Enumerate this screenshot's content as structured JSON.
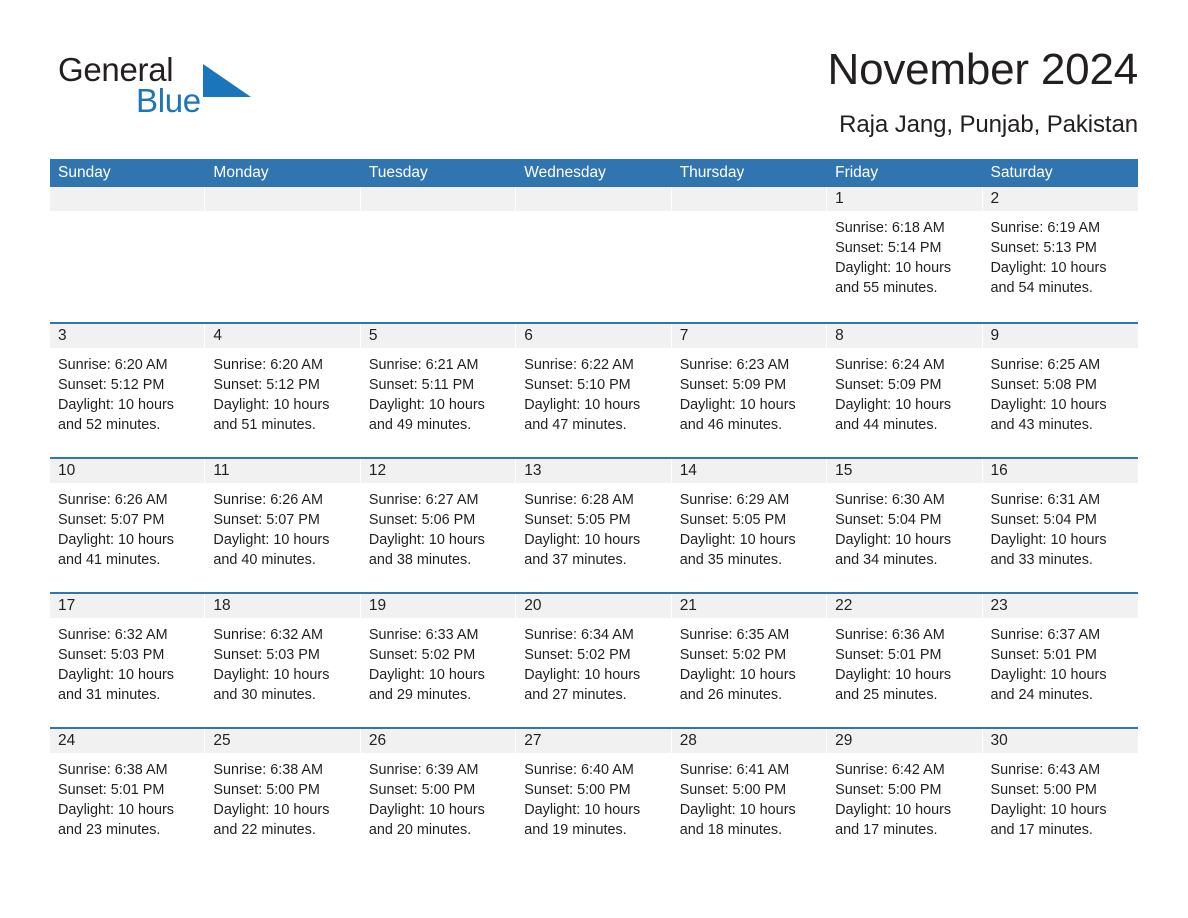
{
  "brand": {
    "name_part1": "General",
    "name_part2": "Blue",
    "triangle_icon": "blue-triangle-icon",
    "accent_color": "#1b75bb"
  },
  "header": {
    "title": "November 2024",
    "subtitle": "Raja Jang, Punjab, Pakistan"
  },
  "colors": {
    "header_blue": "#3175b0",
    "day_band_gray": "#f1f1f1",
    "text": "#231f20",
    "logo_blue": "#1b75bb"
  },
  "weekdays": [
    "Sunday",
    "Monday",
    "Tuesday",
    "Wednesday",
    "Thursday",
    "Friday",
    "Saturday"
  ],
  "weeks": [
    [
      {
        "day": "",
        "sunrise": "",
        "sunset": "",
        "daylight_1": "",
        "daylight_2": ""
      },
      {
        "day": "",
        "sunrise": "",
        "sunset": "",
        "daylight_1": "",
        "daylight_2": ""
      },
      {
        "day": "",
        "sunrise": "",
        "sunset": "",
        "daylight_1": "",
        "daylight_2": ""
      },
      {
        "day": "",
        "sunrise": "",
        "sunset": "",
        "daylight_1": "",
        "daylight_2": ""
      },
      {
        "day": "",
        "sunrise": "",
        "sunset": "",
        "daylight_1": "",
        "daylight_2": ""
      },
      {
        "day": "1",
        "sunrise": "Sunrise: 6:18 AM",
        "sunset": "Sunset: 5:14 PM",
        "daylight_1": "Daylight: 10 hours",
        "daylight_2": "and 55 minutes."
      },
      {
        "day": "2",
        "sunrise": "Sunrise: 6:19 AM",
        "sunset": "Sunset: 5:13 PM",
        "daylight_1": "Daylight: 10 hours",
        "daylight_2": "and 54 minutes."
      }
    ],
    [
      {
        "day": "3",
        "sunrise": "Sunrise: 6:20 AM",
        "sunset": "Sunset: 5:12 PM",
        "daylight_1": "Daylight: 10 hours",
        "daylight_2": "and 52 minutes."
      },
      {
        "day": "4",
        "sunrise": "Sunrise: 6:20 AM",
        "sunset": "Sunset: 5:12 PM",
        "daylight_1": "Daylight: 10 hours",
        "daylight_2": "and 51 minutes."
      },
      {
        "day": "5",
        "sunrise": "Sunrise: 6:21 AM",
        "sunset": "Sunset: 5:11 PM",
        "daylight_1": "Daylight: 10 hours",
        "daylight_2": "and 49 minutes."
      },
      {
        "day": "6",
        "sunrise": "Sunrise: 6:22 AM",
        "sunset": "Sunset: 5:10 PM",
        "daylight_1": "Daylight: 10 hours",
        "daylight_2": "and 47 minutes."
      },
      {
        "day": "7",
        "sunrise": "Sunrise: 6:23 AM",
        "sunset": "Sunset: 5:09 PM",
        "daylight_1": "Daylight: 10 hours",
        "daylight_2": "and 46 minutes."
      },
      {
        "day": "8",
        "sunrise": "Sunrise: 6:24 AM",
        "sunset": "Sunset: 5:09 PM",
        "daylight_1": "Daylight: 10 hours",
        "daylight_2": "and 44 minutes."
      },
      {
        "day": "9",
        "sunrise": "Sunrise: 6:25 AM",
        "sunset": "Sunset: 5:08 PM",
        "daylight_1": "Daylight: 10 hours",
        "daylight_2": "and 43 minutes."
      }
    ],
    [
      {
        "day": "10",
        "sunrise": "Sunrise: 6:26 AM",
        "sunset": "Sunset: 5:07 PM",
        "daylight_1": "Daylight: 10 hours",
        "daylight_2": "and 41 minutes."
      },
      {
        "day": "11",
        "sunrise": "Sunrise: 6:26 AM",
        "sunset": "Sunset: 5:07 PM",
        "daylight_1": "Daylight: 10 hours",
        "daylight_2": "and 40 minutes."
      },
      {
        "day": "12",
        "sunrise": "Sunrise: 6:27 AM",
        "sunset": "Sunset: 5:06 PM",
        "daylight_1": "Daylight: 10 hours",
        "daylight_2": "and 38 minutes."
      },
      {
        "day": "13",
        "sunrise": "Sunrise: 6:28 AM",
        "sunset": "Sunset: 5:05 PM",
        "daylight_1": "Daylight: 10 hours",
        "daylight_2": "and 37 minutes."
      },
      {
        "day": "14",
        "sunrise": "Sunrise: 6:29 AM",
        "sunset": "Sunset: 5:05 PM",
        "daylight_1": "Daylight: 10 hours",
        "daylight_2": "and 35 minutes."
      },
      {
        "day": "15",
        "sunrise": "Sunrise: 6:30 AM",
        "sunset": "Sunset: 5:04 PM",
        "daylight_1": "Daylight: 10 hours",
        "daylight_2": "and 34 minutes."
      },
      {
        "day": "16",
        "sunrise": "Sunrise: 6:31 AM",
        "sunset": "Sunset: 5:04 PM",
        "daylight_1": "Daylight: 10 hours",
        "daylight_2": "and 33 minutes."
      }
    ],
    [
      {
        "day": "17",
        "sunrise": "Sunrise: 6:32 AM",
        "sunset": "Sunset: 5:03 PM",
        "daylight_1": "Daylight: 10 hours",
        "daylight_2": "and 31 minutes."
      },
      {
        "day": "18",
        "sunrise": "Sunrise: 6:32 AM",
        "sunset": "Sunset: 5:03 PM",
        "daylight_1": "Daylight: 10 hours",
        "daylight_2": "and 30 minutes."
      },
      {
        "day": "19",
        "sunrise": "Sunrise: 6:33 AM",
        "sunset": "Sunset: 5:02 PM",
        "daylight_1": "Daylight: 10 hours",
        "daylight_2": "and 29 minutes."
      },
      {
        "day": "20",
        "sunrise": "Sunrise: 6:34 AM",
        "sunset": "Sunset: 5:02 PM",
        "daylight_1": "Daylight: 10 hours",
        "daylight_2": "and 27 minutes."
      },
      {
        "day": "21",
        "sunrise": "Sunrise: 6:35 AM",
        "sunset": "Sunset: 5:02 PM",
        "daylight_1": "Daylight: 10 hours",
        "daylight_2": "and 26 minutes."
      },
      {
        "day": "22",
        "sunrise": "Sunrise: 6:36 AM",
        "sunset": "Sunset: 5:01 PM",
        "daylight_1": "Daylight: 10 hours",
        "daylight_2": "and 25 minutes."
      },
      {
        "day": "23",
        "sunrise": "Sunrise: 6:37 AM",
        "sunset": "Sunset: 5:01 PM",
        "daylight_1": "Daylight: 10 hours",
        "daylight_2": "and 24 minutes."
      }
    ],
    [
      {
        "day": "24",
        "sunrise": "Sunrise: 6:38 AM",
        "sunset": "Sunset: 5:01 PM",
        "daylight_1": "Daylight: 10 hours",
        "daylight_2": "and 23 minutes."
      },
      {
        "day": "25",
        "sunrise": "Sunrise: 6:38 AM",
        "sunset": "Sunset: 5:00 PM",
        "daylight_1": "Daylight: 10 hours",
        "daylight_2": "and 22 minutes."
      },
      {
        "day": "26",
        "sunrise": "Sunrise: 6:39 AM",
        "sunset": "Sunset: 5:00 PM",
        "daylight_1": "Daylight: 10 hours",
        "daylight_2": "and 20 minutes."
      },
      {
        "day": "27",
        "sunrise": "Sunrise: 6:40 AM",
        "sunset": "Sunset: 5:00 PM",
        "daylight_1": "Daylight: 10 hours",
        "daylight_2": "and 19 minutes."
      },
      {
        "day": "28",
        "sunrise": "Sunrise: 6:41 AM",
        "sunset": "Sunset: 5:00 PM",
        "daylight_1": "Daylight: 10 hours",
        "daylight_2": "and 18 minutes."
      },
      {
        "day": "29",
        "sunrise": "Sunrise: 6:42 AM",
        "sunset": "Sunset: 5:00 PM",
        "daylight_1": "Daylight: 10 hours",
        "daylight_2": "and 17 minutes."
      },
      {
        "day": "30",
        "sunrise": "Sunrise: 6:43 AM",
        "sunset": "Sunset: 5:00 PM",
        "daylight_1": "Daylight: 10 hours",
        "daylight_2": "and 17 minutes."
      }
    ]
  ]
}
